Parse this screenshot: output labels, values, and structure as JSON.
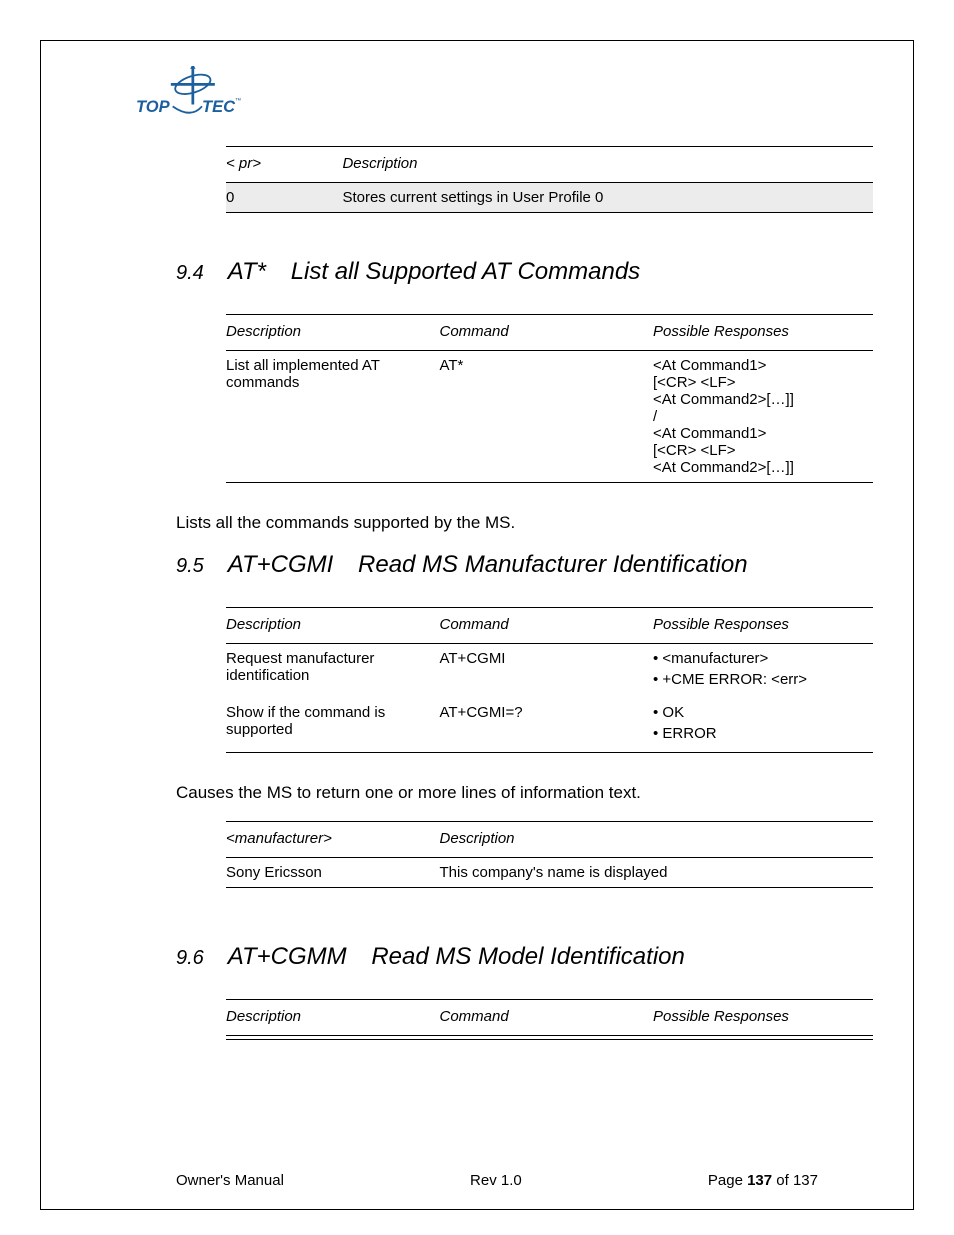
{
  "logo": {
    "top": "TOP",
    "brand": "TEC"
  },
  "table1": {
    "headers": [
      "< pr>",
      "Description"
    ],
    "rows": [
      {
        "c0": "0",
        "c1": "Stores current settings in User Profile 0"
      }
    ]
  },
  "sec94": {
    "num": "9.4",
    "cmd": "AT*",
    "title": "List all Supported AT Commands",
    "table": {
      "headers": [
        "Description",
        "Command",
        "Possible Responses"
      ],
      "rows": [
        {
          "desc": "List all implemented AT commands",
          "cmd": "AT*",
          "resp": "<At Command1>\n[<CR> <LF>\n<At Command2>[…]]\n/\n<At Command1>\n[<CR> <LF>\n<At Command2>[…]]"
        }
      ]
    },
    "body": "Lists all the commands supported by the MS."
  },
  "sec95": {
    "num": "9.5",
    "cmd": "AT+CGMI",
    "title": "Read MS Manufacturer Identification",
    "table": {
      "headers": [
        "Description",
        "Command",
        "Possible Responses"
      ],
      "rows": [
        {
          "desc": "Request manufacturer identification",
          "cmd": "AT+CGMI",
          "resp": [
            "<manufacturer>",
            "+CME ERROR: <err>"
          ]
        },
        {
          "desc": "Show if the command is supported",
          "cmd": "AT+CGMI=?",
          "resp": [
            "OK",
            "ERROR"
          ]
        }
      ]
    },
    "body": "Causes the MS to return one or more lines of information text.",
    "table2": {
      "headers": [
        "<manufacturer>",
        "Description"
      ],
      "rows": [
        {
          "c0": "Sony Ericsson",
          "c1": "This company's name is displayed"
        }
      ]
    }
  },
  "sec96": {
    "num": "9.6",
    "cmd": "AT+CGMM",
    "title": "Read MS Model Identification",
    "table": {
      "headers": [
        "Description",
        "Command",
        "Possible Responses"
      ]
    }
  },
  "footer": {
    "left": "Owner's Manual",
    "center": "Rev 1.0",
    "page_label": "Page ",
    "page_num": "137",
    "page_of": " of 137"
  }
}
